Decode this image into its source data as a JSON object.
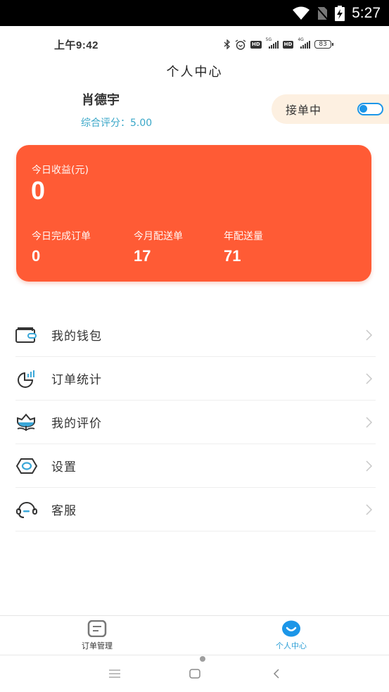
{
  "system_status": {
    "time": "5:27",
    "icons": [
      "wifi-icon",
      "no-sim-icon",
      "battery-charging-icon"
    ]
  },
  "inner_status": {
    "time": "上午9:42",
    "icons": [
      "bluetooth-icon",
      "alarm-icon",
      "hd-icon",
      "signal-5g-icon",
      "hd-icon",
      "signal-4g-icon",
      "battery-icon"
    ],
    "hd_label": "HD",
    "sig1_label": "5G",
    "sig2_label": "4G",
    "battery_level": "83"
  },
  "header": {
    "title": "个人中心"
  },
  "profile": {
    "name": "肖德宇",
    "score_label": "综合评分：",
    "score_value": "5.00",
    "score_text": "综合评分：5.00"
  },
  "order_toggle": {
    "label": "接单中",
    "on": true,
    "color": "#1c96e8"
  },
  "earnings_card": {
    "color": "#ff5b35",
    "today_label": "今日收益(元)",
    "today_value": "0",
    "stats": [
      {
        "label": "今日完成订单",
        "value": "0"
      },
      {
        "label": "今月配送单",
        "value": "17"
      },
      {
        "label": "年配送量",
        "value": "71"
      }
    ]
  },
  "menu": {
    "items": [
      {
        "label": "我的钱包",
        "icon": "wallet-icon"
      },
      {
        "label": "订单统计",
        "icon": "chart-icon"
      },
      {
        "label": "我的评价",
        "icon": "flower-icon"
      },
      {
        "label": "设置",
        "icon": "settings-icon"
      },
      {
        "label": "客服",
        "icon": "headset-icon"
      }
    ]
  },
  "tab_bar": {
    "tabs": [
      {
        "label": "订单管理",
        "icon": "order-list-icon",
        "active": false
      },
      {
        "label": "个人中心",
        "icon": "smile-icon",
        "active": true
      }
    ],
    "active_color": "#2d9fd6"
  },
  "nav_bar": {
    "buttons": [
      "menu-icon",
      "home-icon",
      "back-icon"
    ]
  }
}
